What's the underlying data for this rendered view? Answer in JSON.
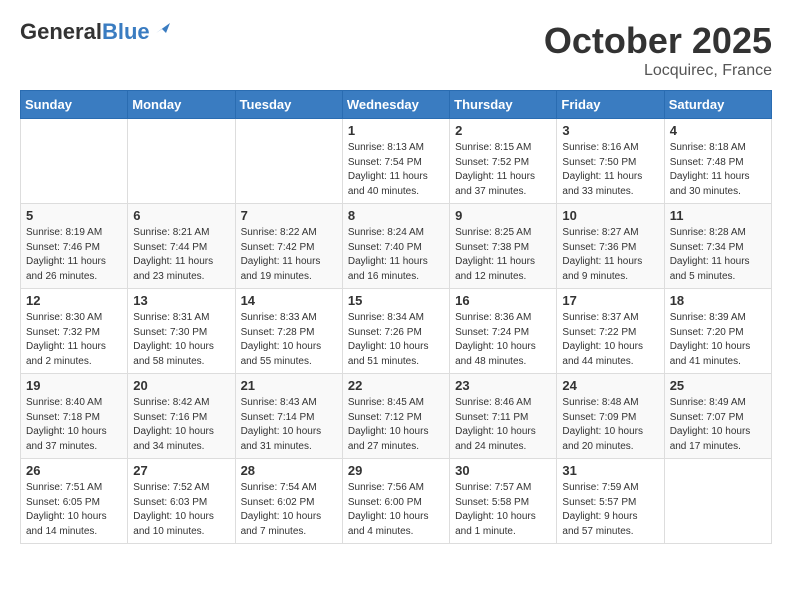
{
  "header": {
    "logo_general": "General",
    "logo_blue": "Blue",
    "month": "October 2025",
    "location": "Locquirec, France"
  },
  "weekdays": [
    "Sunday",
    "Monday",
    "Tuesday",
    "Wednesday",
    "Thursday",
    "Friday",
    "Saturday"
  ],
  "weeks": [
    [
      {
        "day": "",
        "info": ""
      },
      {
        "day": "",
        "info": ""
      },
      {
        "day": "",
        "info": ""
      },
      {
        "day": "1",
        "info": "Sunrise: 8:13 AM\nSunset: 7:54 PM\nDaylight: 11 hours\nand 40 minutes."
      },
      {
        "day": "2",
        "info": "Sunrise: 8:15 AM\nSunset: 7:52 PM\nDaylight: 11 hours\nand 37 minutes."
      },
      {
        "day": "3",
        "info": "Sunrise: 8:16 AM\nSunset: 7:50 PM\nDaylight: 11 hours\nand 33 minutes."
      },
      {
        "day": "4",
        "info": "Sunrise: 8:18 AM\nSunset: 7:48 PM\nDaylight: 11 hours\nand 30 minutes."
      }
    ],
    [
      {
        "day": "5",
        "info": "Sunrise: 8:19 AM\nSunset: 7:46 PM\nDaylight: 11 hours\nand 26 minutes."
      },
      {
        "day": "6",
        "info": "Sunrise: 8:21 AM\nSunset: 7:44 PM\nDaylight: 11 hours\nand 23 minutes."
      },
      {
        "day": "7",
        "info": "Sunrise: 8:22 AM\nSunset: 7:42 PM\nDaylight: 11 hours\nand 19 minutes."
      },
      {
        "day": "8",
        "info": "Sunrise: 8:24 AM\nSunset: 7:40 PM\nDaylight: 11 hours\nand 16 minutes."
      },
      {
        "day": "9",
        "info": "Sunrise: 8:25 AM\nSunset: 7:38 PM\nDaylight: 11 hours\nand 12 minutes."
      },
      {
        "day": "10",
        "info": "Sunrise: 8:27 AM\nSunset: 7:36 PM\nDaylight: 11 hours\nand 9 minutes."
      },
      {
        "day": "11",
        "info": "Sunrise: 8:28 AM\nSunset: 7:34 PM\nDaylight: 11 hours\nand 5 minutes."
      }
    ],
    [
      {
        "day": "12",
        "info": "Sunrise: 8:30 AM\nSunset: 7:32 PM\nDaylight: 11 hours\nand 2 minutes."
      },
      {
        "day": "13",
        "info": "Sunrise: 8:31 AM\nSunset: 7:30 PM\nDaylight: 10 hours\nand 58 minutes."
      },
      {
        "day": "14",
        "info": "Sunrise: 8:33 AM\nSunset: 7:28 PM\nDaylight: 10 hours\nand 55 minutes."
      },
      {
        "day": "15",
        "info": "Sunrise: 8:34 AM\nSunset: 7:26 PM\nDaylight: 10 hours\nand 51 minutes."
      },
      {
        "day": "16",
        "info": "Sunrise: 8:36 AM\nSunset: 7:24 PM\nDaylight: 10 hours\nand 48 minutes."
      },
      {
        "day": "17",
        "info": "Sunrise: 8:37 AM\nSunset: 7:22 PM\nDaylight: 10 hours\nand 44 minutes."
      },
      {
        "day": "18",
        "info": "Sunrise: 8:39 AM\nSunset: 7:20 PM\nDaylight: 10 hours\nand 41 minutes."
      }
    ],
    [
      {
        "day": "19",
        "info": "Sunrise: 8:40 AM\nSunset: 7:18 PM\nDaylight: 10 hours\nand 37 minutes."
      },
      {
        "day": "20",
        "info": "Sunrise: 8:42 AM\nSunset: 7:16 PM\nDaylight: 10 hours\nand 34 minutes."
      },
      {
        "day": "21",
        "info": "Sunrise: 8:43 AM\nSunset: 7:14 PM\nDaylight: 10 hours\nand 31 minutes."
      },
      {
        "day": "22",
        "info": "Sunrise: 8:45 AM\nSunset: 7:12 PM\nDaylight: 10 hours\nand 27 minutes."
      },
      {
        "day": "23",
        "info": "Sunrise: 8:46 AM\nSunset: 7:11 PM\nDaylight: 10 hours\nand 24 minutes."
      },
      {
        "day": "24",
        "info": "Sunrise: 8:48 AM\nSunset: 7:09 PM\nDaylight: 10 hours\nand 20 minutes."
      },
      {
        "day": "25",
        "info": "Sunrise: 8:49 AM\nSunset: 7:07 PM\nDaylight: 10 hours\nand 17 minutes."
      }
    ],
    [
      {
        "day": "26",
        "info": "Sunrise: 7:51 AM\nSunset: 6:05 PM\nDaylight: 10 hours\nand 14 minutes."
      },
      {
        "day": "27",
        "info": "Sunrise: 7:52 AM\nSunset: 6:03 PM\nDaylight: 10 hours\nand 10 minutes."
      },
      {
        "day": "28",
        "info": "Sunrise: 7:54 AM\nSunset: 6:02 PM\nDaylight: 10 hours\nand 7 minutes."
      },
      {
        "day": "29",
        "info": "Sunrise: 7:56 AM\nSunset: 6:00 PM\nDaylight: 10 hours\nand 4 minutes."
      },
      {
        "day": "30",
        "info": "Sunrise: 7:57 AM\nSunset: 5:58 PM\nDaylight: 10 hours\nand 1 minute."
      },
      {
        "day": "31",
        "info": "Sunrise: 7:59 AM\nSunset: 5:57 PM\nDaylight: 9 hours\nand 57 minutes."
      },
      {
        "day": "",
        "info": ""
      }
    ]
  ]
}
